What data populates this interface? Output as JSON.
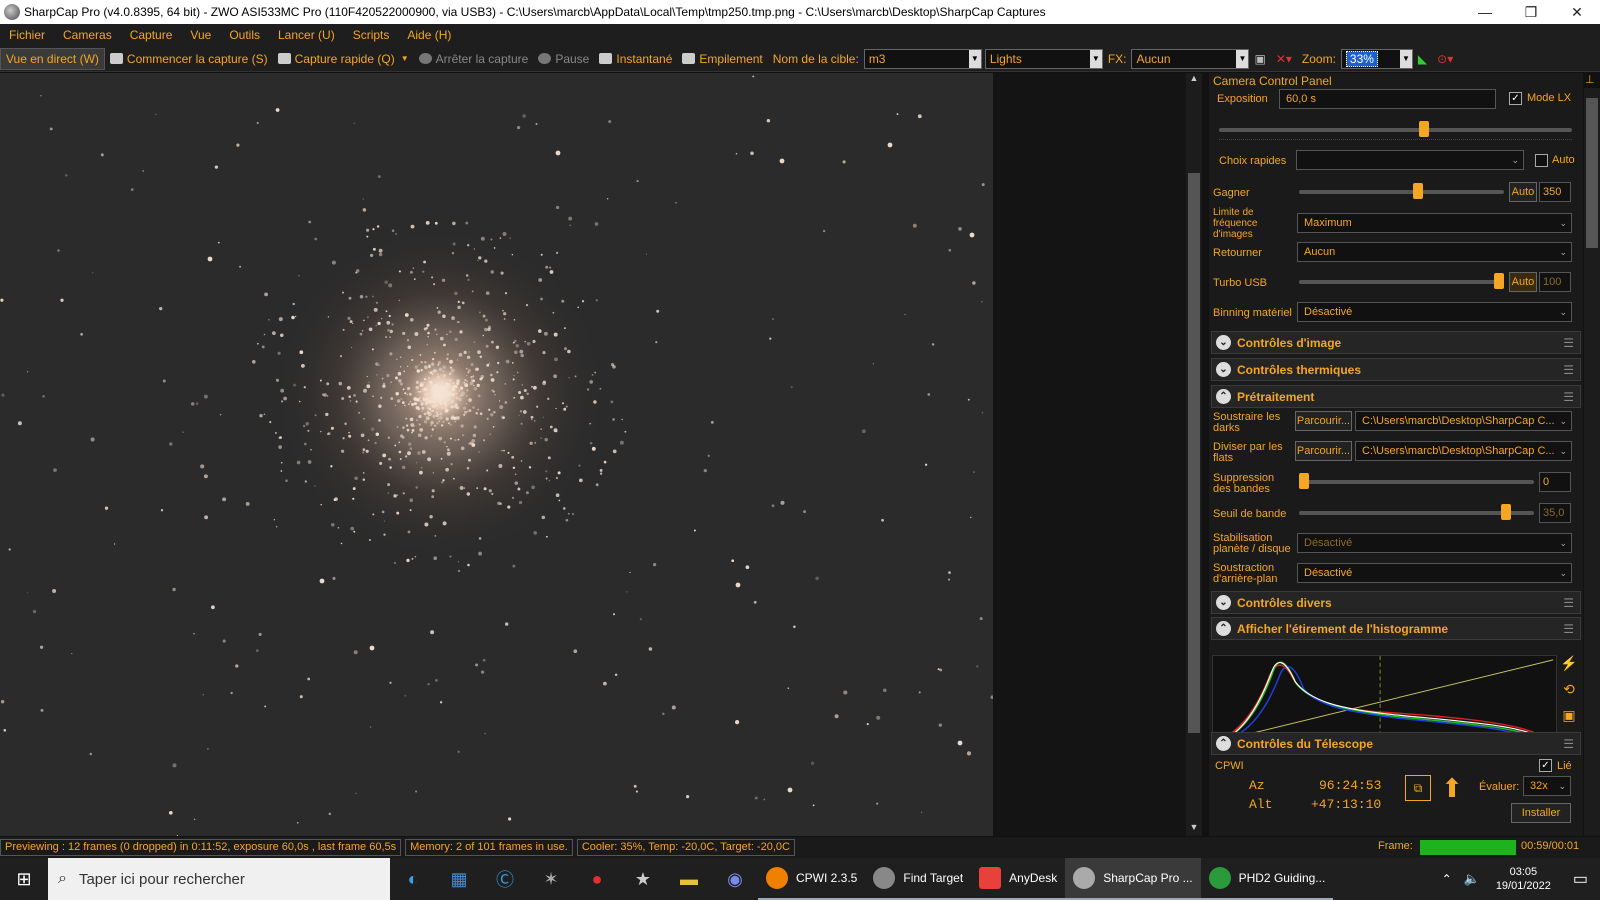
{
  "window": {
    "title": "SharpCap Pro (v4.0.8395, 64 bit) - ZWO ASI533MC Pro (110F420522000900, via USB3) - C:\\Users\\marcb\\AppData\\Local\\Temp\\tmp250.tmp.png - C:\\Users\\marcb\\Desktop\\SharpCap Captures",
    "minimize": "—",
    "maximize": "❐",
    "close": "✕"
  },
  "menu": [
    "Fichier",
    "Cameras",
    "Capture",
    "Vue",
    "Outils",
    "Lancer (U)",
    "Scripts",
    "Aide (H)"
  ],
  "toolbar": {
    "live_view": "Vue en direct (W)",
    "start_capture": "Commencer la capture (S)",
    "quick_capture": "Capture rapide (Q)",
    "stop_capture": "Arrêter la capture",
    "pause": "Pause",
    "snapshot": "Instantané",
    "stacking": "Empilement",
    "target_label": "Nom de la cible:",
    "target_value": "m3",
    "frame_type": "Lights",
    "fx_label": "FX:",
    "fx_value": "Aucun",
    "zoom_label": "Zoom:",
    "zoom_value": "33%"
  },
  "panel": {
    "title": "Camera Control Panel",
    "exposure": {
      "label": "Exposition",
      "value": "60,0 s",
      "lx_label": "Mode LX",
      "lx_checked": true,
      "slider": 0.58
    },
    "quick_picks": {
      "label": "Choix rapides",
      "value": "",
      "auto_label": "Auto"
    },
    "gain": {
      "label": "Gagner",
      "auto": "Auto",
      "value": "350",
      "slider": 0.58
    },
    "frame_rate": {
      "label": "Limite de fréquence d'images",
      "value": "Maximum"
    },
    "flip": {
      "label": "Retourner",
      "value": "Aucun"
    },
    "turbo": {
      "label": "Turbo USB",
      "auto": "Auto",
      "value": "100",
      "slider": 1.0
    },
    "binning": {
      "label": "Binning matériel",
      "value": "Désactivé"
    },
    "sections": {
      "image": "Contrôles d'image",
      "thermal": "Contrôles thermiques",
      "preprocessing": "Prétraitement",
      "misc": "Contrôles divers",
      "histogram": "Afficher l'étirement de l'histogramme",
      "telescope": "Contrôles du Télescope"
    },
    "darks": {
      "label": "Soustraire les darks",
      "browse": "Parcourir...",
      "path": "C:\\Users\\marcb\\Desktop\\SharpCap C..."
    },
    "flats": {
      "label": "Diviser par les flats",
      "browse": "Parcourir...",
      "path": "C:\\Users\\marcb\\Desktop\\SharpCap C..."
    },
    "banding": {
      "label": "Suppression des bandes",
      "value": "0",
      "slider": 0.0
    },
    "band_threshold": {
      "label": "Seuil de bande",
      "value": "35,0",
      "slider": 0.88
    },
    "stabilisation": {
      "label": "Stabilisation planète / disque",
      "value": "Désactivé"
    },
    "bg_subtract": {
      "label": "Soustraction d'arrière-plan",
      "value": "Désactivé"
    },
    "telescope": {
      "name": "CPWI",
      "linked_label": "Lié",
      "linked": true,
      "az_label": "Az",
      "az_value": "96:24:53",
      "alt_label": "Alt",
      "alt_value": "+47:13:10",
      "rate_label": "Évaluer:",
      "rate_value": "32x",
      "install": "Installer"
    }
  },
  "status": {
    "preview": "Previewing : 12 frames (0 dropped) in 0:11:52, exposure 60,0s , last frame 60,5s",
    "memory": "Memory: 2 of 101 frames in use.",
    "cooler": "Cooler: 35%, Temp: -20,0C, Target: -20,0C",
    "frame_label": "Frame:",
    "frame_time": "00:59/00:01"
  },
  "taskbar": {
    "search_placeholder": "Taper ici pour rechercher",
    "apps": [
      {
        "name": "CPWI 2.3.5",
        "color": "#f08000"
      },
      {
        "name": "Find Target",
        "color": "#888888"
      },
      {
        "name": "AnyDesk",
        "color": "#e8403a"
      },
      {
        "name": "SharpCap Pro ...",
        "color": "#aaaaaa"
      },
      {
        "name": "PHD2 Guiding...",
        "color": "#2a9a3a"
      }
    ],
    "time": "03:05",
    "date": "19/01/2022"
  },
  "colors": {
    "accent": "#f5a623",
    "frame_bar": "#1db31d"
  }
}
